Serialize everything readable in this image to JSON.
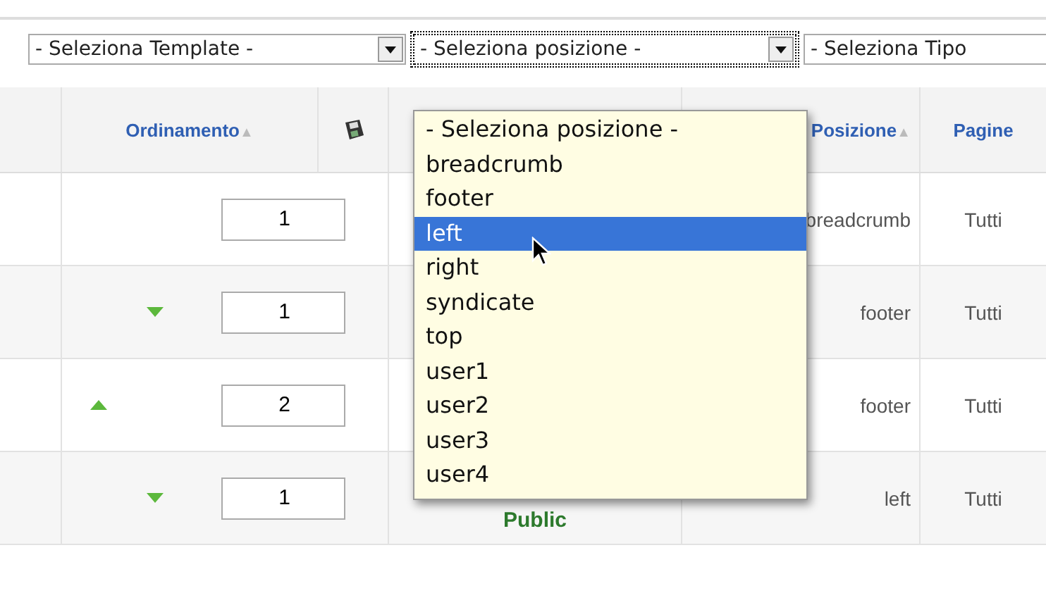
{
  "filters": [
    {
      "value": "- Seleziona Template -",
      "focused": false
    },
    {
      "value": "- Seleziona posizione -",
      "focused": true
    },
    {
      "value": "- Seleziona Tipo",
      "focused": false
    }
  ],
  "table": {
    "columns": [
      {
        "label": "Ordinamento",
        "sort": "▲"
      },
      {
        "label": "Posizione",
        "sort": "▲"
      },
      {
        "label": "Pagine"
      }
    ],
    "rows": [
      {
        "move_up": false,
        "move_down": false,
        "order": "1",
        "position": "breadcrumb",
        "pages": "Tutti"
      },
      {
        "move_up": false,
        "move_down": true,
        "order": "1",
        "position": "footer",
        "pages": "Tutti"
      },
      {
        "move_up": true,
        "move_down": false,
        "order": "2",
        "position": "footer",
        "pages": "Tutti"
      },
      {
        "move_up": false,
        "move_down": true,
        "order": "1",
        "column_3": "Public",
        "position": "left",
        "pages": "Tutti"
      }
    ]
  },
  "dropdown": {
    "options": [
      {
        "label": "- Seleziona posizione -",
        "selected": false
      },
      {
        "label": "breadcrumb",
        "selected": false
      },
      {
        "label": "footer",
        "selected": false
      },
      {
        "label": "left",
        "selected": true
      },
      {
        "label": "right",
        "selected": false
      },
      {
        "label": "syndicate",
        "selected": false
      },
      {
        "label": "top",
        "selected": false
      },
      {
        "label": "user1",
        "selected": false
      },
      {
        "label": "user2",
        "selected": false
      },
      {
        "label": "user3",
        "selected": false
      },
      {
        "label": "user4",
        "selected": false
      }
    ]
  }
}
